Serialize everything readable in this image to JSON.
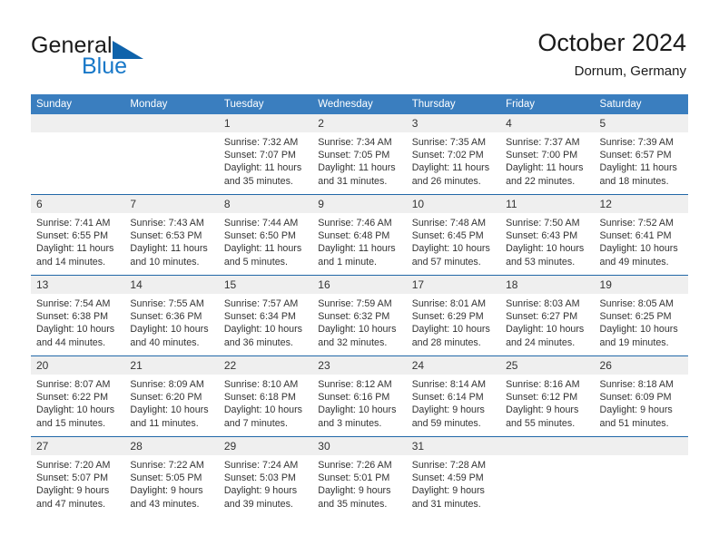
{
  "brand": {
    "name_part1": "General",
    "name_part2": "Blue",
    "logo_icon": "triangle-logo-icon"
  },
  "header": {
    "title": "October 2024",
    "subtitle": "Dornum, Germany"
  },
  "colors": {
    "header_blue": "#3a7ebf",
    "divider_blue": "#2268a8",
    "daynum_bg": "#efefef",
    "brand_blue": "#1878c8",
    "text": "#333333"
  },
  "weekday_headers": [
    "Sunday",
    "Monday",
    "Tuesday",
    "Wednesday",
    "Thursday",
    "Friday",
    "Saturday"
  ],
  "labels": {
    "sunrise_prefix": "Sunrise:",
    "sunset_prefix": "Sunset:",
    "daylight_prefix": "Daylight:"
  },
  "weeks": [
    [
      {
        "day": "",
        "sunrise": "",
        "sunset": "",
        "daylight": "",
        "blank": true
      },
      {
        "day": "",
        "sunrise": "",
        "sunset": "",
        "daylight": "",
        "blank": true
      },
      {
        "day": "1",
        "sunrise": "Sunrise: 7:32 AM",
        "sunset": "Sunset: 7:07 PM",
        "daylight": "Daylight: 11 hours and 35 minutes."
      },
      {
        "day": "2",
        "sunrise": "Sunrise: 7:34 AM",
        "sunset": "Sunset: 7:05 PM",
        "daylight": "Daylight: 11 hours and 31 minutes."
      },
      {
        "day": "3",
        "sunrise": "Sunrise: 7:35 AM",
        "sunset": "Sunset: 7:02 PM",
        "daylight": "Daylight: 11 hours and 26 minutes."
      },
      {
        "day": "4",
        "sunrise": "Sunrise: 7:37 AM",
        "sunset": "Sunset: 7:00 PM",
        "daylight": "Daylight: 11 hours and 22 minutes."
      },
      {
        "day": "5",
        "sunrise": "Sunrise: 7:39 AM",
        "sunset": "Sunset: 6:57 PM",
        "daylight": "Daylight: 11 hours and 18 minutes."
      }
    ],
    [
      {
        "day": "6",
        "sunrise": "Sunrise: 7:41 AM",
        "sunset": "Sunset: 6:55 PM",
        "daylight": "Daylight: 11 hours and 14 minutes."
      },
      {
        "day": "7",
        "sunrise": "Sunrise: 7:43 AM",
        "sunset": "Sunset: 6:53 PM",
        "daylight": "Daylight: 11 hours and 10 minutes."
      },
      {
        "day": "8",
        "sunrise": "Sunrise: 7:44 AM",
        "sunset": "Sunset: 6:50 PM",
        "daylight": "Daylight: 11 hours and 5 minutes."
      },
      {
        "day": "9",
        "sunrise": "Sunrise: 7:46 AM",
        "sunset": "Sunset: 6:48 PM",
        "daylight": "Daylight: 11 hours and 1 minute."
      },
      {
        "day": "10",
        "sunrise": "Sunrise: 7:48 AM",
        "sunset": "Sunset: 6:45 PM",
        "daylight": "Daylight: 10 hours and 57 minutes."
      },
      {
        "day": "11",
        "sunrise": "Sunrise: 7:50 AM",
        "sunset": "Sunset: 6:43 PM",
        "daylight": "Daylight: 10 hours and 53 minutes."
      },
      {
        "day": "12",
        "sunrise": "Sunrise: 7:52 AM",
        "sunset": "Sunset: 6:41 PM",
        "daylight": "Daylight: 10 hours and 49 minutes."
      }
    ],
    [
      {
        "day": "13",
        "sunrise": "Sunrise: 7:54 AM",
        "sunset": "Sunset: 6:38 PM",
        "daylight": "Daylight: 10 hours and 44 minutes."
      },
      {
        "day": "14",
        "sunrise": "Sunrise: 7:55 AM",
        "sunset": "Sunset: 6:36 PM",
        "daylight": "Daylight: 10 hours and 40 minutes."
      },
      {
        "day": "15",
        "sunrise": "Sunrise: 7:57 AM",
        "sunset": "Sunset: 6:34 PM",
        "daylight": "Daylight: 10 hours and 36 minutes."
      },
      {
        "day": "16",
        "sunrise": "Sunrise: 7:59 AM",
        "sunset": "Sunset: 6:32 PM",
        "daylight": "Daylight: 10 hours and 32 minutes."
      },
      {
        "day": "17",
        "sunrise": "Sunrise: 8:01 AM",
        "sunset": "Sunset: 6:29 PM",
        "daylight": "Daylight: 10 hours and 28 minutes."
      },
      {
        "day": "18",
        "sunrise": "Sunrise: 8:03 AM",
        "sunset": "Sunset: 6:27 PM",
        "daylight": "Daylight: 10 hours and 24 minutes."
      },
      {
        "day": "19",
        "sunrise": "Sunrise: 8:05 AM",
        "sunset": "Sunset: 6:25 PM",
        "daylight": "Daylight: 10 hours and 19 minutes."
      }
    ],
    [
      {
        "day": "20",
        "sunrise": "Sunrise: 8:07 AM",
        "sunset": "Sunset: 6:22 PM",
        "daylight": "Daylight: 10 hours and 15 minutes."
      },
      {
        "day": "21",
        "sunrise": "Sunrise: 8:09 AM",
        "sunset": "Sunset: 6:20 PM",
        "daylight": "Daylight: 10 hours and 11 minutes."
      },
      {
        "day": "22",
        "sunrise": "Sunrise: 8:10 AM",
        "sunset": "Sunset: 6:18 PM",
        "daylight": "Daylight: 10 hours and 7 minutes."
      },
      {
        "day": "23",
        "sunrise": "Sunrise: 8:12 AM",
        "sunset": "Sunset: 6:16 PM",
        "daylight": "Daylight: 10 hours and 3 minutes."
      },
      {
        "day": "24",
        "sunrise": "Sunrise: 8:14 AM",
        "sunset": "Sunset: 6:14 PM",
        "daylight": "Daylight: 9 hours and 59 minutes."
      },
      {
        "day": "25",
        "sunrise": "Sunrise: 8:16 AM",
        "sunset": "Sunset: 6:12 PM",
        "daylight": "Daylight: 9 hours and 55 minutes."
      },
      {
        "day": "26",
        "sunrise": "Sunrise: 8:18 AM",
        "sunset": "Sunset: 6:09 PM",
        "daylight": "Daylight: 9 hours and 51 minutes."
      }
    ],
    [
      {
        "day": "27",
        "sunrise": "Sunrise: 7:20 AM",
        "sunset": "Sunset: 5:07 PM",
        "daylight": "Daylight: 9 hours and 47 minutes."
      },
      {
        "day": "28",
        "sunrise": "Sunrise: 7:22 AM",
        "sunset": "Sunset: 5:05 PM",
        "daylight": "Daylight: 9 hours and 43 minutes."
      },
      {
        "day": "29",
        "sunrise": "Sunrise: 7:24 AM",
        "sunset": "Sunset: 5:03 PM",
        "daylight": "Daylight: 9 hours and 39 minutes."
      },
      {
        "day": "30",
        "sunrise": "Sunrise: 7:26 AM",
        "sunset": "Sunset: 5:01 PM",
        "daylight": "Daylight: 9 hours and 35 minutes."
      },
      {
        "day": "31",
        "sunrise": "Sunrise: 7:28 AM",
        "sunset": "Sunset: 4:59 PM",
        "daylight": "Daylight: 9 hours and 31 minutes."
      },
      {
        "day": "",
        "sunrise": "",
        "sunset": "",
        "daylight": "",
        "blank": true
      },
      {
        "day": "",
        "sunrise": "",
        "sunset": "",
        "daylight": "",
        "blank": true
      }
    ]
  ]
}
